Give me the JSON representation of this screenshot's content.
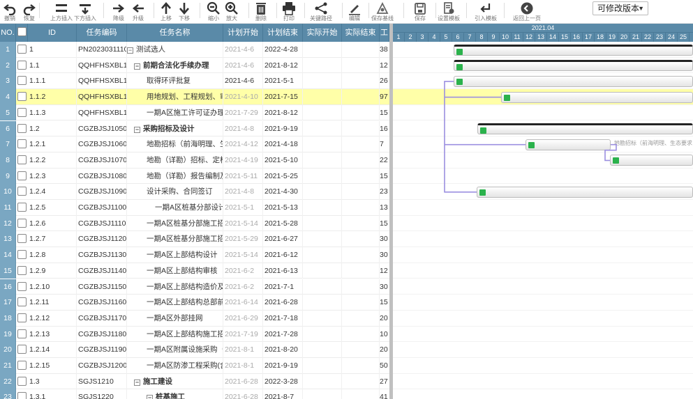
{
  "toolbar": {
    "buttons": [
      {
        "label": "撤销",
        "icon": "undo-icon"
      },
      {
        "label": "恢复",
        "icon": "redo-icon"
      },
      {
        "label": "上方插入",
        "icon": "insert-above-icon"
      },
      {
        "label": "下方插入",
        "icon": "insert-below-icon"
      },
      {
        "label": "降级",
        "icon": "indent-icon"
      },
      {
        "label": "升级",
        "icon": "outdent-icon"
      },
      {
        "label": "上移",
        "icon": "move-up-icon"
      },
      {
        "label": "下移",
        "icon": "move-down-icon"
      },
      {
        "label": "缩小",
        "icon": "zoom-out-icon"
      },
      {
        "label": "放大",
        "icon": "zoom-in-icon"
      },
      {
        "label": "删除",
        "icon": "trash-icon"
      },
      {
        "label": "打印",
        "icon": "print-icon"
      },
      {
        "label": "关键路径",
        "icon": "critical-path-icon"
      },
      {
        "label": "编辑",
        "icon": "edit-icon"
      },
      {
        "label": "保存基线",
        "icon": "save-baseline-icon"
      },
      {
        "label": "保存",
        "icon": "save-icon"
      },
      {
        "label": "设置模板",
        "icon": "template-settings-icon"
      },
      {
        "label": "引入模板",
        "icon": "import-template-icon"
      },
      {
        "label": "返回上一页",
        "icon": "back-icon"
      }
    ],
    "version_select": "可修改版本"
  },
  "grid": {
    "columns": [
      "NO.",
      "ID",
      "任务编码",
      "任务名称",
      "计划开始",
      "计划结束",
      "实际开始",
      "实际结束",
      "工"
    ],
    "rows": [
      {
        "no": "1",
        "id": "1",
        "code": "PN2023031110",
        "name": "测试选人",
        "toggle": "⊟",
        "ps": "2021-4-6",
        "pe": "2022-4-28",
        "dur": "38",
        "level": 0,
        "bold": false,
        "grey": true
      },
      {
        "no": "2",
        "id": "1.1",
        "code": "QQHFHSXBL1(",
        "name": "前期合法化手续办理",
        "toggle": "⊟",
        "ps": "2021-4-6",
        "pe": "2021-8-12",
        "dur": "12",
        "level": 1,
        "bold": true,
        "grey": true
      },
      {
        "no": "3",
        "id": "1.1.1",
        "code": "QQHFHSXBL1(",
        "name": "取得环评批复",
        "toggle": "",
        "ps": "2021-4-6",
        "pe": "2021-5-1",
        "dur": "26",
        "level": 2,
        "bold": false,
        "grey": false
      },
      {
        "no": "4",
        "id": "1.1.2",
        "code": "QQHFHSXBL1(",
        "name": "用地规划、工程规划、审",
        "toggle": "",
        "ps": "2021-4-10",
        "pe": "2021-7-15",
        "dur": "97",
        "level": 2,
        "bold": false,
        "grey": true
      },
      {
        "no": "5",
        "id": "1.1.3",
        "code": "QQHFHSXBL1(",
        "name": "一期A区施工许可证办理",
        "toggle": "",
        "ps": "2021-7-29",
        "pe": "2021-8-12",
        "dur": "15",
        "level": 2,
        "bold": false,
        "grey": true
      },
      {
        "no": "6",
        "id": "1.2",
        "code": "CGZBJSJ1050",
        "name": "采购招标及设计",
        "toggle": "⊟",
        "ps": "2021-4-8",
        "pe": "2021-9-19",
        "dur": "16",
        "level": 1,
        "bold": true,
        "grey": true
      },
      {
        "no": "7",
        "id": "1.2.1",
        "code": "CGZBJSJ1060",
        "name": "地勘招标（前海明理、生",
        "toggle": "",
        "ps": "2021-4-12",
        "pe": "2021-4-18",
        "dur": "7",
        "level": 2,
        "bold": false,
        "grey": true
      },
      {
        "no": "8",
        "id": "1.2.2",
        "code": "CGZBJSJ1070",
        "name": "地勘（详勘）招标、定标",
        "toggle": "",
        "ps": "2021-4-19",
        "pe": "2021-5-10",
        "dur": "22",
        "level": 2,
        "bold": false,
        "grey": true
      },
      {
        "no": "9",
        "id": "1.2.3",
        "code": "CGZBJSJ1080",
        "name": "地勘（详勘）报告编制及",
        "toggle": "",
        "ps": "2021-5-11",
        "pe": "2021-5-25",
        "dur": "15",
        "level": 2,
        "bold": false,
        "grey": true
      },
      {
        "no": "10",
        "id": "1.2.4",
        "code": "CGZBJSJ1090",
        "name": "设计采购、合同签订",
        "toggle": "",
        "ps": "2021-4-8",
        "pe": "2021-4-30",
        "dur": "23",
        "level": 2,
        "bold": false,
        "grey": true
      },
      {
        "no": "11",
        "id": "1.2.5",
        "code": "CGZBJSJ1100",
        "name": "一期A区桩基分部设计及",
        "toggle": "",
        "ps": "2021-5-1",
        "pe": "2021-5-13",
        "dur": "13",
        "level": 3,
        "bold": false,
        "grey": true
      },
      {
        "no": "12",
        "id": "1.2.6",
        "code": "CGZBJSJ1110",
        "name": "一期A区桩基分部施工招",
        "toggle": "",
        "ps": "2021-5-14",
        "pe": "2021-5-28",
        "dur": "15",
        "level": 2,
        "bold": false,
        "grey": true
      },
      {
        "no": "13",
        "id": "1.2.7",
        "code": "CGZBJSJ1120",
        "name": "一期A区桩基分部施工招",
        "toggle": "",
        "ps": "2021-5-29",
        "pe": "2021-6-27",
        "dur": "30",
        "level": 2,
        "bold": false,
        "grey": true
      },
      {
        "no": "14",
        "id": "1.2.8",
        "code": "CGZBJSJ1130",
        "name": "一期A区上部结构设计",
        "toggle": "",
        "ps": "2021-5-14",
        "pe": "2021-6-12",
        "dur": "30",
        "level": 2,
        "bold": false,
        "grey": true
      },
      {
        "no": "15",
        "id": "1.2.9",
        "code": "CGZBJSJ1140",
        "name": "一期A区上部结构审核",
        "toggle": "",
        "ps": "2021-6-2",
        "pe": "2021-6-13",
        "dur": "12",
        "level": 2,
        "bold": false,
        "grey": true
      },
      {
        "no": "16",
        "id": "1.2.10",
        "code": "CGZBJSJ1150",
        "name": "一期A区上部结构造价及",
        "toggle": "",
        "ps": "2021-6-2",
        "pe": "2021-7-1",
        "dur": "30",
        "level": 2,
        "bold": false,
        "grey": true
      },
      {
        "no": "17",
        "id": "1.2.11",
        "code": "CGZBJSJ1160",
        "name": "一期A区上部结构总部前",
        "toggle": "",
        "ps": "2021-6-14",
        "pe": "2021-6-28",
        "dur": "15",
        "level": 2,
        "bold": false,
        "grey": true
      },
      {
        "no": "18",
        "id": "1.2.12",
        "code": "CGZBJSJ1170",
        "name": "一期A区外部挂网",
        "toggle": "",
        "ps": "2021-6-29",
        "pe": "2021-7-18",
        "dur": "20",
        "level": 2,
        "bold": false,
        "grey": true
      },
      {
        "no": "19",
        "id": "1.2.13",
        "code": "CGZBJSJ1180",
        "name": "一期A区上部结构施工招",
        "toggle": "",
        "ps": "2021-7-19",
        "pe": "2021-7-28",
        "dur": "10",
        "level": 2,
        "bold": false,
        "grey": true
      },
      {
        "no": "20",
        "id": "1.2.14",
        "code": "CGZBJSJ1190",
        "name": "一期A区附属设施采购（",
        "toggle": "",
        "ps": "2021-8-1",
        "pe": "2021-8-20",
        "dur": "20",
        "level": 2,
        "bold": false,
        "grey": true
      },
      {
        "no": "21",
        "id": "1.2.15",
        "code": "CGZBJSJ1200",
        "name": "一期A区防渗工程采购(含",
        "toggle": "",
        "ps": "2021-8-1",
        "pe": "2021-9-19",
        "dur": "50",
        "level": 2,
        "bold": false,
        "grey": true
      },
      {
        "no": "22",
        "id": "1.3",
        "code": "SGJS1210",
        "name": "施工建设",
        "toggle": "⊟",
        "ps": "2021-6-28",
        "pe": "2022-3-28",
        "dur": "27",
        "level": 1,
        "bold": true,
        "grey": true
      },
      {
        "no": "23",
        "id": "1.3.1",
        "code": "SGJS1220",
        "name": "桩基施工",
        "toggle": "⊟",
        "ps": "2021-6-28",
        "pe": "2021-8-7",
        "dur": "41",
        "level": 2,
        "bold": true,
        "grey": true
      }
    ]
  },
  "gantt": {
    "month_label": "2021.04",
    "days": [
      "1",
      "2",
      "3",
      "4",
      "5",
      "6",
      "7",
      "8",
      "9",
      "10",
      "11",
      "12",
      "13",
      "14",
      "15",
      "16",
      "17",
      "18",
      "19",
      "20",
      "21",
      "22",
      "23",
      "24",
      "25"
    ],
    "bar_label_row7": "地勘招标（前海明理、生态要求",
    "colors": {
      "progress": "#2bb24c",
      "link": "#9b8fe0",
      "header": "#5a8aa8",
      "selected_row": "#ffffa8"
    }
  }
}
